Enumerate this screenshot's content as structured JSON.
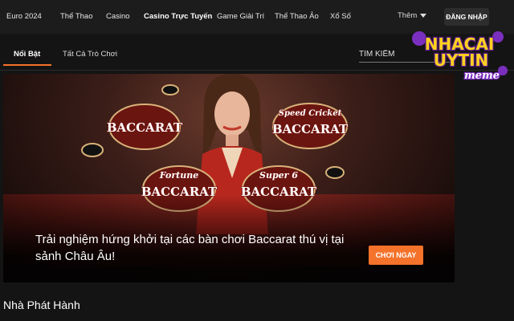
{
  "nav": {
    "items": [
      {
        "label": "Euro 2024"
      },
      {
        "label": "Thể Thao"
      },
      {
        "label": "Casino"
      },
      {
        "label": "Casino Trực Tuyến"
      },
      {
        "label": "Game Giải Trí"
      },
      {
        "label": "Thể Thao Ảo"
      },
      {
        "label": "Xổ Số"
      }
    ],
    "more_label": "Thêm",
    "login_label": "ĐĂNG NHẬP"
  },
  "subnav": {
    "tabs": [
      {
        "label": "Nổi Bật"
      },
      {
        "label": "Tất Cả Trò Chơi"
      }
    ],
    "search_placeholder": "TÌM KIẾM"
  },
  "logo": {
    "line1": "NHACAI",
    "line2": "UYTIN",
    "line3": "meme"
  },
  "banner": {
    "games": [
      {
        "title": "BACCARAT",
        "subtitle": ""
      },
      {
        "title": "BACCARAT",
        "subtitle": "Speed Cricket"
      },
      {
        "title": "BACCARAT",
        "subtitle": "Fortune"
      },
      {
        "title": "BACCARAT",
        "subtitle": "Super 6"
      }
    ],
    "headline": "Trải nghiệm hứng khởi tại các bàn chơi Baccarat thú vị tại sảnh Châu Âu!",
    "cta_label": "CHƠI NGAY"
  },
  "section": {
    "title": "Nhà Phát Hành"
  },
  "colors": {
    "accent": "#f5722a",
    "nav_bg": "#1c1c1c",
    "page_bg": "#141414"
  }
}
